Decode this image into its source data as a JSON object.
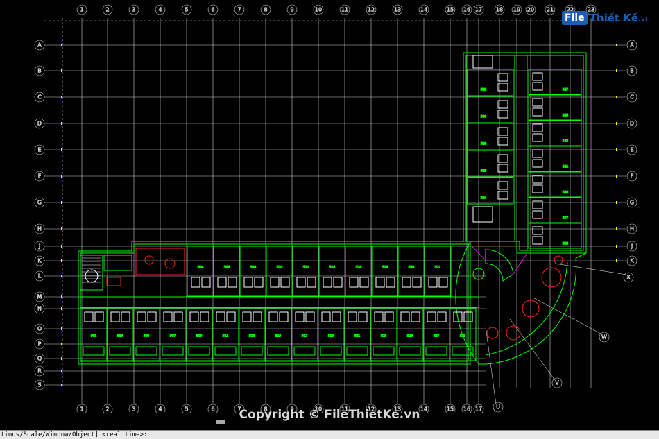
{
  "app": {
    "logo_brand": "File",
    "logo_name": "Thiết Kế",
    "logo_tld": ".vn",
    "copyright": "Copyright © FileThietKe.vn",
    "command_line": "tious/Scale/Window/Object] <real time>:"
  },
  "grid": {
    "columns": [
      "1",
      "2",
      "3",
      "4",
      "5",
      "6",
      "7",
      "8",
      "9",
      "10",
      "11",
      "12",
      "13",
      "14",
      "15",
      "16",
      "17",
      "18",
      "19",
      "20",
      "21",
      "22",
      "23"
    ],
    "rows": [
      "A",
      "B",
      "C",
      "D",
      "E",
      "F",
      "G",
      "H",
      "J",
      "K",
      "L",
      "M",
      "N",
      "O",
      "P",
      "Q",
      "R",
      "S"
    ],
    "radial_axes": [
      "U",
      "V",
      "W",
      "X"
    ]
  },
  "rooms": {
    "north_row": [
      "504",
      "506",
      "508",
      "510",
      "512",
      "514",
      "516",
      "518",
      "520",
      "522"
    ],
    "south_row": [
      "501",
      "503",
      "505",
      "507",
      "509",
      "511",
      "513",
      "515",
      "517",
      "519",
      "521",
      "523",
      "525",
      "527",
      "529"
    ],
    "wing_left": [
      "532",
      "530",
      "528",
      "526",
      "524"
    ],
    "wing_right": [
      "547",
      "545",
      "543",
      "541",
      "539",
      "537",
      "535"
    ]
  },
  "colors": {
    "grid": "#d0d0d0",
    "walls": "#00ff00",
    "furniture": "#ffffff",
    "fixtures": "#ff2020",
    "magenta": "#ff00ff",
    "yellow": "#ffff00",
    "logo": "#1a5fb4"
  }
}
